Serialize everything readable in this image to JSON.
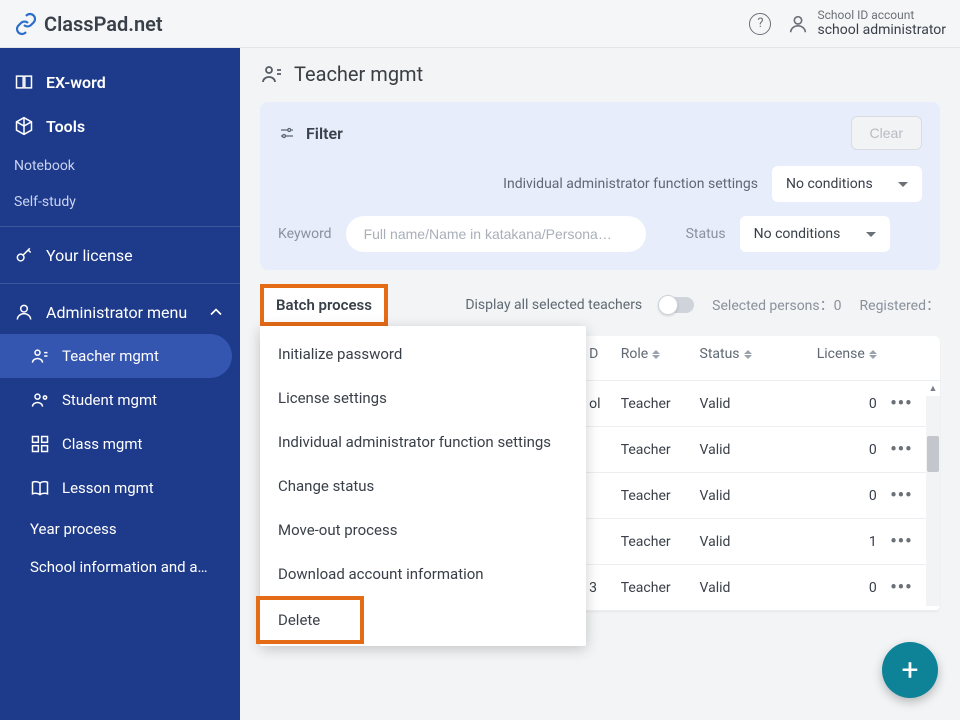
{
  "brand": {
    "name": "ClassPad.net"
  },
  "header": {
    "account_type": "School ID account",
    "role": "school administrator"
  },
  "sidebar": {
    "exword": "EX-word",
    "tools": "Tools",
    "notebook": "Notebook",
    "selfstudy": "Self-study",
    "license": "Your license",
    "admin_menu": "Administrator menu",
    "teacher_mgmt": "Teacher mgmt",
    "student_mgmt": "Student mgmt",
    "class_mgmt": "Class mgmt",
    "lesson_mgmt": "Lesson mgmt",
    "year_process": "Year process",
    "school_info": "School information and a…"
  },
  "page": {
    "title": "Teacher mgmt"
  },
  "filter": {
    "title": "Filter",
    "clear": "Clear",
    "admin_label": "Individual administrator function settings",
    "admin_value": "No conditions",
    "keyword_label": "Keyword",
    "keyword_placeholder": "Full name/Name in katakana/Persona…",
    "status_label": "Status",
    "status_value": "No conditions"
  },
  "listbar": {
    "batch": "Batch process",
    "display_all": "Display all selected teachers",
    "selected_label": "Selected persons：",
    "selected_count": "0",
    "registered_label": "Registered："
  },
  "batch_menu": {
    "items": [
      "Initialize password",
      "License settings",
      "Individual administrator function settings",
      "Change status",
      "Move-out process",
      "Download account information"
    ],
    "delete": "Delete"
  },
  "table": {
    "headers": {
      "d": "D",
      "role": "Role",
      "status": "Status",
      "license": "License"
    },
    "rows": [
      {
        "d": "ol",
        "role": "Teacher",
        "status": "Valid",
        "license": "0"
      },
      {
        "d": "",
        "role": "Teacher",
        "status": "Valid",
        "license": "0"
      },
      {
        "d": "",
        "role": "Teacher",
        "status": "Valid",
        "license": "0"
      },
      {
        "d": "",
        "role": "Teacher",
        "status": "Valid",
        "license": "1"
      },
      {
        "d": "3",
        "role": "Teacher",
        "status": "Valid",
        "license": "0"
      }
    ]
  }
}
